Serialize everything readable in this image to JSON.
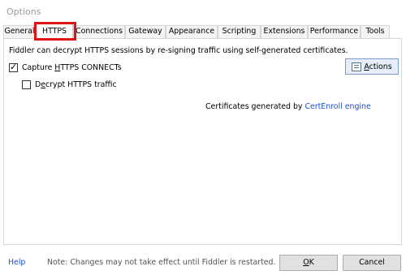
{
  "window": {
    "title": "Options"
  },
  "tabs": [
    {
      "label": "General",
      "active": false
    },
    {
      "label": "HTTPS",
      "active": true
    },
    {
      "label": "Connections",
      "active": false
    },
    {
      "label": "Gateway",
      "active": false
    },
    {
      "label": "Appearance",
      "active": false
    },
    {
      "label": "Scripting",
      "active": false
    },
    {
      "label": "Extensions",
      "active": false
    },
    {
      "label": "Performance",
      "active": false
    },
    {
      "label": "Tools",
      "active": false
    }
  ],
  "https_panel": {
    "description": "Fiddler can decrypt HTTPS sessions by re-signing traffic using self-generated certificates.",
    "capture_checkbox": {
      "label_pre": "Capture ",
      "label_accel": "H",
      "label_post": "TTPS CONNECTs",
      "checked": true
    },
    "decrypt_checkbox": {
      "label_pre": "D",
      "label_accel": "e",
      "label_post": "crypt HTTPS traffic",
      "checked": false
    },
    "actions_button": {
      "label_accel": "A",
      "label_rest": "ctions"
    },
    "cert_text": "Certificates generated by ",
    "cert_link": "CertEnroll engine"
  },
  "footer": {
    "help_link": "Help",
    "note": "Note: Changes may not take effect until Fiddler is restarted.",
    "ok_accel": "O",
    "ok_rest": "K",
    "cancel_label": "Cancel"
  },
  "colors": {
    "highlight_border": "#e01414",
    "link": "#1a4fd1"
  }
}
